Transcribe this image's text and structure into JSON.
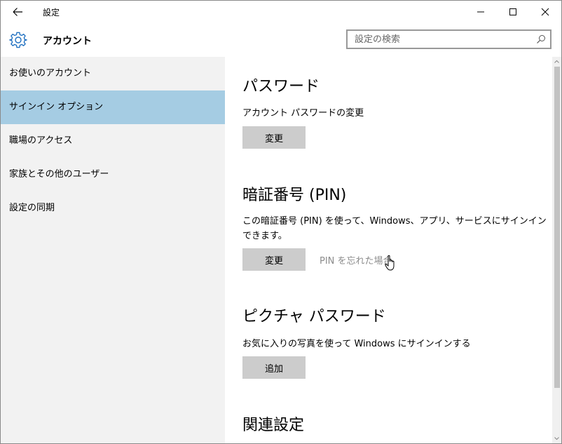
{
  "window": {
    "title": "設定",
    "back_icon": "arrow-left-icon",
    "controls": [
      "minimize-icon",
      "maximize-icon",
      "close-icon"
    ]
  },
  "header": {
    "icon": "gear-icon",
    "title": "アカウント",
    "search_placeholder": "設定の検索",
    "search_icon": "search-icon"
  },
  "sidebar": {
    "items": [
      {
        "label": "お使いのアカウント"
      },
      {
        "label": "サインイン オプション",
        "selected": true
      },
      {
        "label": "職場のアクセス"
      },
      {
        "label": "家族とその他のユーザー"
      },
      {
        "label": "設定の同期"
      }
    ],
    "selected_color": "#a5cce3"
  },
  "main": {
    "password": {
      "heading": "パスワード",
      "description": "アカウント パスワードの変更",
      "button": "変更"
    },
    "pin": {
      "heading": "暗証番号 (PIN)",
      "description": "この暗証番号 (PIN) を使って、Windows、アプリ、サービスにサインインできます。",
      "button": "変更",
      "link": "PIN を忘れた場合"
    },
    "picture_password": {
      "heading": "ピクチャ パスワード",
      "description": "お気に入りの写真を使って Windows にサインインする",
      "button": "追加"
    },
    "related": {
      "heading": "関連設定"
    }
  }
}
